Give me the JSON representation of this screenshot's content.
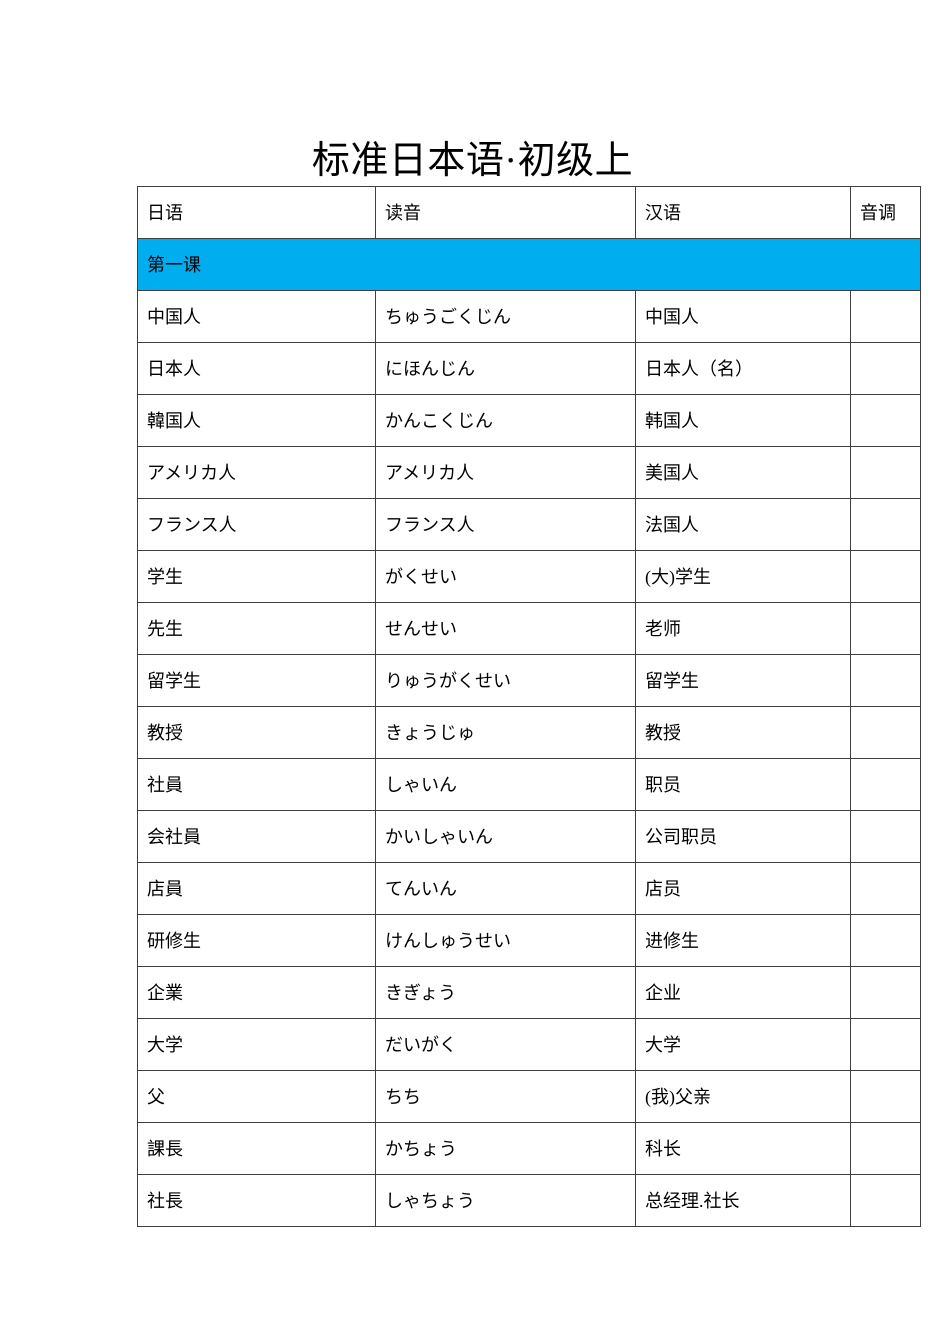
{
  "document": {
    "title": "标准日本语·初级上"
  },
  "table": {
    "headers": {
      "japanese": "日语",
      "reading": "读音",
      "chinese": "汉语",
      "pitch": "音调"
    },
    "lesson_label": "第一课",
    "accent_color": "#00AEEF",
    "rows": [
      {
        "japanese": "中国人",
        "reading": "ちゅうごくじん",
        "chinese": "中国人",
        "pitch": ""
      },
      {
        "japanese": "日本人",
        "reading": "にほんじん",
        "chinese": "日本人（名）",
        "pitch": ""
      },
      {
        "japanese": "韓国人",
        "reading": "かんこくじん",
        "chinese": "韩国人",
        "pitch": ""
      },
      {
        "japanese": "アメリカ人",
        "reading": "アメリカ人",
        "chinese": "美国人",
        "pitch": ""
      },
      {
        "japanese": "フランス人",
        "reading": "フランス人",
        "chinese": "法国人",
        "pitch": ""
      },
      {
        "japanese": "学生",
        "reading": "がくせい",
        "chinese": "(大)学生",
        "pitch": ""
      },
      {
        "japanese": "先生",
        "reading": "せんせい",
        "chinese": "老师",
        "pitch": ""
      },
      {
        "japanese": "留学生",
        "reading": "りゅうがくせい",
        "chinese": "留学生",
        "pitch": ""
      },
      {
        "japanese": "教授",
        "reading": "きょうじゅ",
        "chinese": "教授",
        "pitch": ""
      },
      {
        "japanese": "社員",
        "reading": "しゃいん",
        "chinese": "职员",
        "pitch": ""
      },
      {
        "japanese": "会社員",
        "reading": "かいしゃいん",
        "chinese": "公司职员",
        "pitch": ""
      },
      {
        "japanese": "店員",
        "reading": "てんいん",
        "chinese": "店员",
        "pitch": ""
      },
      {
        "japanese": "研修生",
        "reading": "けんしゅうせい",
        "chinese": "进修生",
        "pitch": ""
      },
      {
        "japanese": "企業",
        "reading": "きぎょう",
        "chinese": "企业",
        "pitch": ""
      },
      {
        "japanese": "大学",
        "reading": "だいがく",
        "chinese": "大学",
        "pitch": ""
      },
      {
        "japanese": "父",
        "reading": "ちち",
        "chinese": "(我)父亲",
        "pitch": ""
      },
      {
        "japanese": "課長",
        "reading": "かちょう",
        "chinese": "科长",
        "pitch": ""
      },
      {
        "japanese": "社長",
        "reading": "しゃちょう",
        "chinese": "总经理.社长",
        "pitch": ""
      }
    ]
  }
}
